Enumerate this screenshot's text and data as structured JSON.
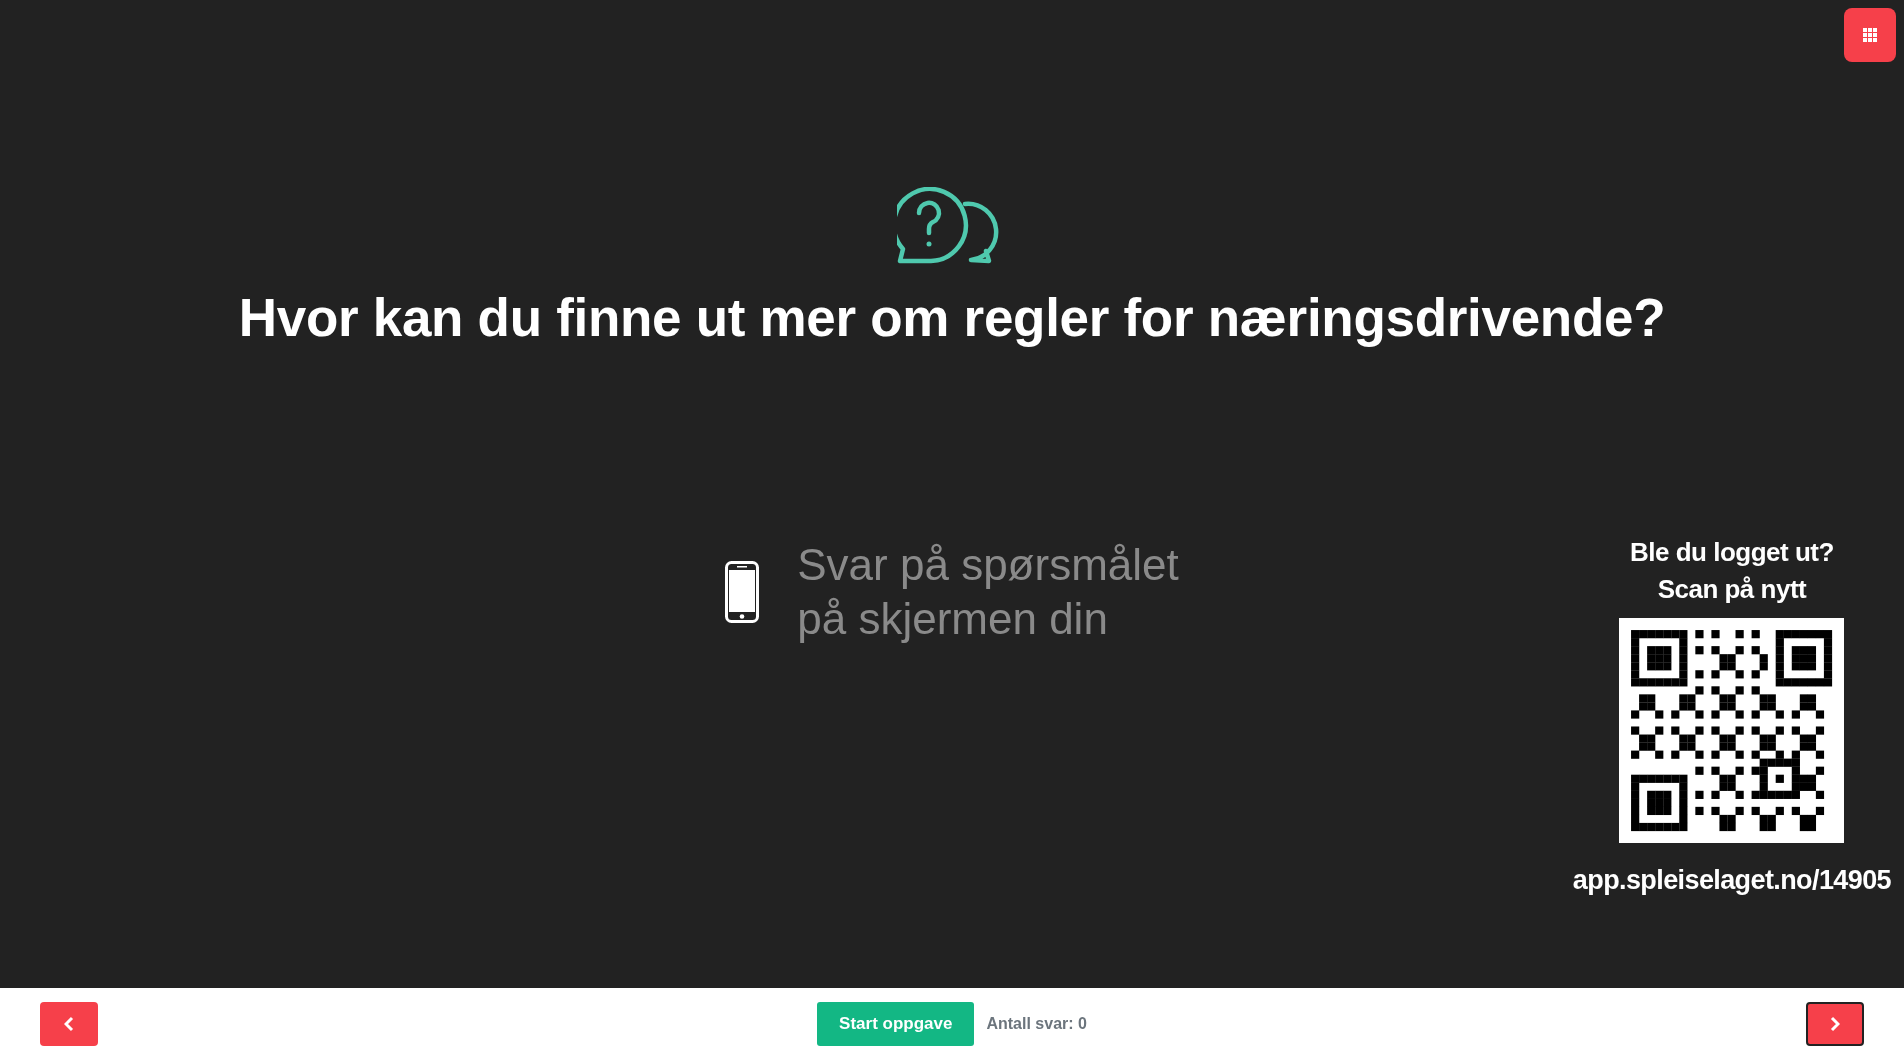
{
  "question": {
    "title": "Hvor kan du finne ut mer om regler for næringsdrivende?"
  },
  "instruction": {
    "lines": [
      "Svar på spørsmålet",
      "på skjermen din"
    ]
  },
  "relogin": {
    "lines": [
      "Ble du logget ut?",
      "Scan på nytt"
    ],
    "url": "app.spleiselaget.no/14905"
  },
  "footer": {
    "start_button": "Start oppgave",
    "answer_count": "Antall svar: 0"
  }
}
